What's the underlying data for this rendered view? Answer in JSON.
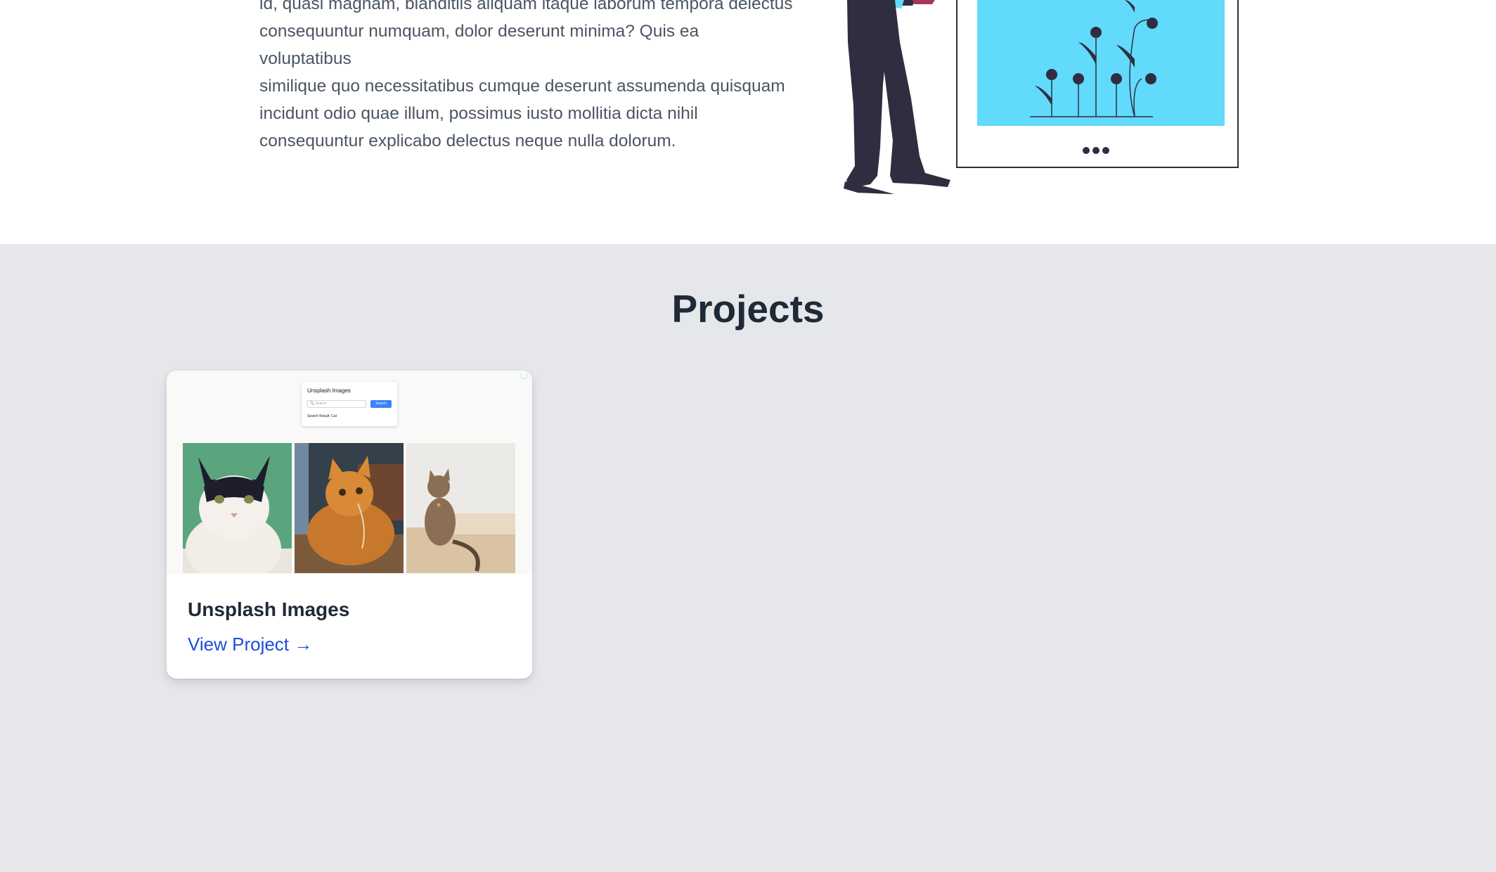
{
  "about": {
    "paragraph_lines": [
      "id, quasi magnam, blanditiis aliquam itaque laborum tempora delectus",
      "consequuntur numquam, dolor deserunt minima? Quis ea voluptatibus",
      "similique quo necessitatibus cumque deserunt assumenda quisquam",
      "incidunt odio quae illum, possimus iusto mollitia dicta nihil",
      "consequuntur explicabo delectus neque nulla dolorum."
    ]
  },
  "projects": {
    "heading": "Projects",
    "cards": [
      {
        "title": "Unsplash Images",
        "link_label": "View Project →",
        "thumbnail": {
          "panel_title": "Unsplash Images",
          "search_placeholder": "🔍 Search",
          "search_button": "Search",
          "result_text": "Search Result: Cat"
        }
      }
    ]
  },
  "colors": {
    "accent_link": "#1d4ed8",
    "section_bg": "#e5e7eb",
    "illustration_cyan": "#61dafb",
    "illustration_dark": "#2f2e41"
  },
  "icons": {
    "link_arrow": "right-arrow-icon",
    "loading": "spinner-icon"
  }
}
